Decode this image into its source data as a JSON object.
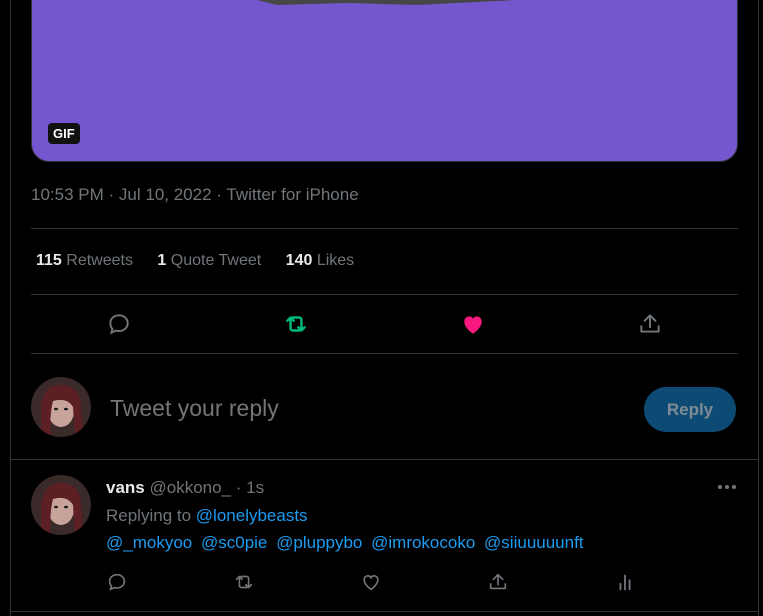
{
  "media": {
    "badge": "GIF"
  },
  "tweet": {
    "time": "10:53 PM",
    "date": "Jul 10, 2022",
    "source": "Twitter for iPhone",
    "sep": "·"
  },
  "stats": {
    "retweets_count": "115",
    "retweets_label": "Retweets",
    "quotes_count": "1",
    "quotes_label": "Quote Tweet",
    "likes_count": "140",
    "likes_label": "Likes"
  },
  "actions": {
    "icons": [
      "reply-icon",
      "retweet-icon",
      "like-icon",
      "share-icon"
    ],
    "retweet_color": "#00ba7c",
    "like_color": "#f91880"
  },
  "composer": {
    "placeholder": "Tweet your reply",
    "button_label": "Reply"
  },
  "reply": {
    "name": "vans",
    "handle": "@okkono_",
    "sep": "·",
    "time": "1s",
    "replying_prefix": "Replying to",
    "replying_to": "@lonelybeasts",
    "mentions": [
      "@_mokyoo",
      "@sc0pie",
      "@pluppybo",
      "@imrokocoko",
      "@siiuuuuunft"
    ],
    "icons": [
      "reply-icon",
      "retweet-icon",
      "like-icon",
      "share-icon",
      "analytics-icon"
    ]
  },
  "colors": {
    "accent": "#1d9bf0",
    "media_bg": "#7457cf"
  }
}
